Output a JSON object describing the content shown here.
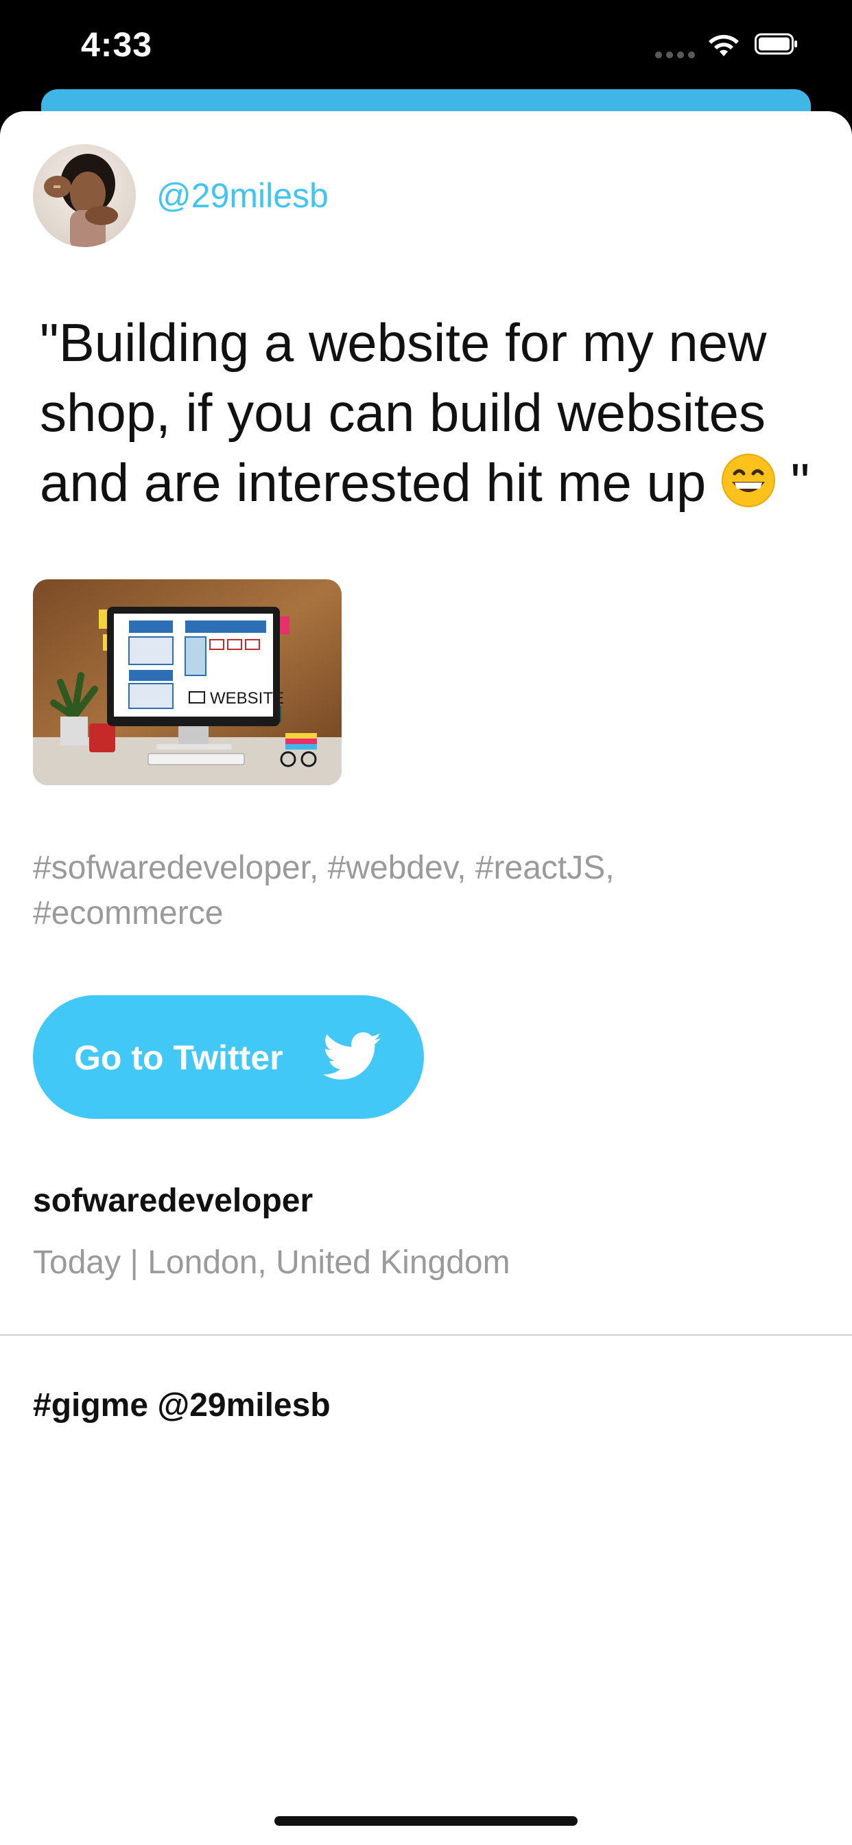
{
  "status_bar": {
    "time": "4:33"
  },
  "post": {
    "handle": "@29milesb",
    "quote_text": "\"Building a website for my new shop, if you can build websites and are interested hit me up ",
    "quote_close": " \"",
    "emoji": "grinning-face-with-smiling-eyes",
    "image_caption": "WEBSITE",
    "hashtags": "#sofwaredeveloper, #webdev, #reactJS, #ecommerce",
    "button_label": "Go to Twitter",
    "category": "sofwaredeveloper",
    "meta": "Today | London, United Kingdom",
    "footer_tag": "#gigme @29milesb"
  },
  "colors": {
    "accent": "#41c8f7",
    "handle": "#3fc5f0",
    "back_card": "#3fb6e6",
    "muted_text": "#9a9a9a"
  },
  "icons": {
    "button_icon": "twitter-bird-icon",
    "status": [
      "signal-icon",
      "wifi-icon",
      "battery-icon"
    ]
  }
}
